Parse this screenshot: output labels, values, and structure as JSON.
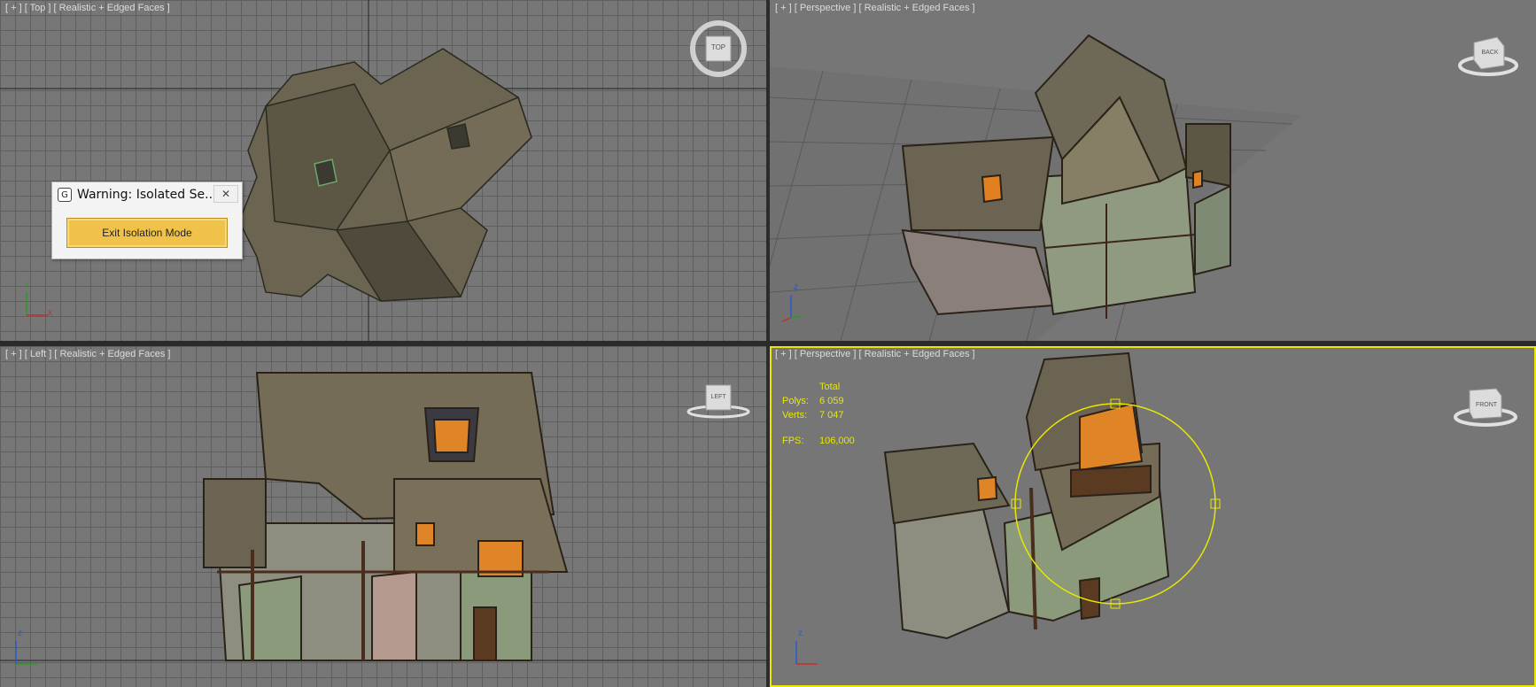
{
  "viewports": {
    "top_left": {
      "label": "[ + ] [ Top ] [ Realistic + Edged Faces ]",
      "cube_label": "TOP"
    },
    "top_right": {
      "label": "[ + ] [ Perspective ] [ Realistic + Edged Faces ]",
      "cube_label": "BACK"
    },
    "bottom_left": {
      "label": "[ + ] [ Left ] [ Realistic + Edged Faces ]",
      "cube_label": "LEFT"
    },
    "bottom_right": {
      "label": "[ + ] [ Perspective ] [ Realistic + Edged Faces ]",
      "cube_label": "FRONT"
    }
  },
  "stats": {
    "total_label": "Total",
    "polys_label": "Polys:",
    "polys_value": "6 059",
    "verts_label": "Verts:",
    "verts_value": "7 047",
    "fps_label": "FPS:",
    "fps_value": "106,000"
  },
  "axes": {
    "x": "x",
    "y": "y",
    "z": "z"
  },
  "dialog": {
    "title": "Warning: Isolated Se...",
    "close_glyph": "✕",
    "app_glyph": "G",
    "button_label": "Exit Isolation Mode"
  },
  "colors": {
    "active_border": "#e8e800",
    "button": "#f0c24a",
    "viewport_bg": "#777777"
  }
}
